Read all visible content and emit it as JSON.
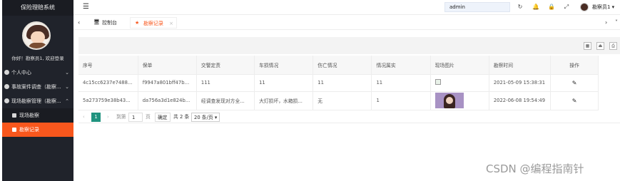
{
  "app": {
    "title": "保险理赔系统"
  },
  "sidebar": {
    "greeting": "你好！勘察员1, 欢迎登录",
    "items": [
      {
        "label": "个人中心",
        "chevron": "⌄"
      },
      {
        "label": "事故案件调查（勘察...",
        "chevron": "⌄"
      },
      {
        "label": "现场勘察管理（勘察...",
        "chevron": "⌃"
      },
      {
        "label": "现场勘察"
      },
      {
        "label": "勘察记录"
      }
    ]
  },
  "header": {
    "menu_icon": "☰",
    "search_value": "admin",
    "icons": {
      "refresh": "↻",
      "notify": "🔔",
      "lock": "🔒",
      "fullscreen": "⤢"
    },
    "username": "勘察员1 ▾"
  },
  "tabs": {
    "prev": "‹",
    "next": "›",
    "more": "˅",
    "items": [
      {
        "label": "控制台",
        "icon": "🖥"
      },
      {
        "label": "勘察记录",
        "icon": "★",
        "close": "×"
      }
    ]
  },
  "toolbar": {
    "columns_icon": "▦",
    "export_icon": "⏏",
    "print_icon": "⎙"
  },
  "table": {
    "headers": [
      "序号",
      "保单",
      "交警定责",
      "车损情况",
      "伤亡情况",
      "情况属实",
      "现场图片",
      "勘察时间",
      "操作"
    ],
    "rows": [
      [
        "4c15cc6237e7488...",
        "f9947a801bff47b0...",
        "111",
        "11",
        "11",
        "11",
        "",
        "2021-05-09 15:38:31",
        ""
      ],
      [
        "5a273759e38b43...",
        "da756a3d1e824b...",
        "经调查发现对方全...",
        "大灯损坏，水箱损...",
        "无",
        "1",
        "",
        "2022-06-08 19:54:49",
        ""
      ]
    ],
    "edit_icon": "✎"
  },
  "pager": {
    "prev": "‹",
    "current_page": "1",
    "next": "›",
    "goto_label": "到第",
    "page_input": "1",
    "page_unit": "页",
    "confirm": "确定",
    "total": "共 2 条",
    "page_size": "20 条/页 ▾"
  },
  "watermark": "CSDN @编程指南针",
  "colors": {
    "accent": "#f8571d",
    "sidebar_bg": "#20232b",
    "pager_active": "#20937f"
  }
}
